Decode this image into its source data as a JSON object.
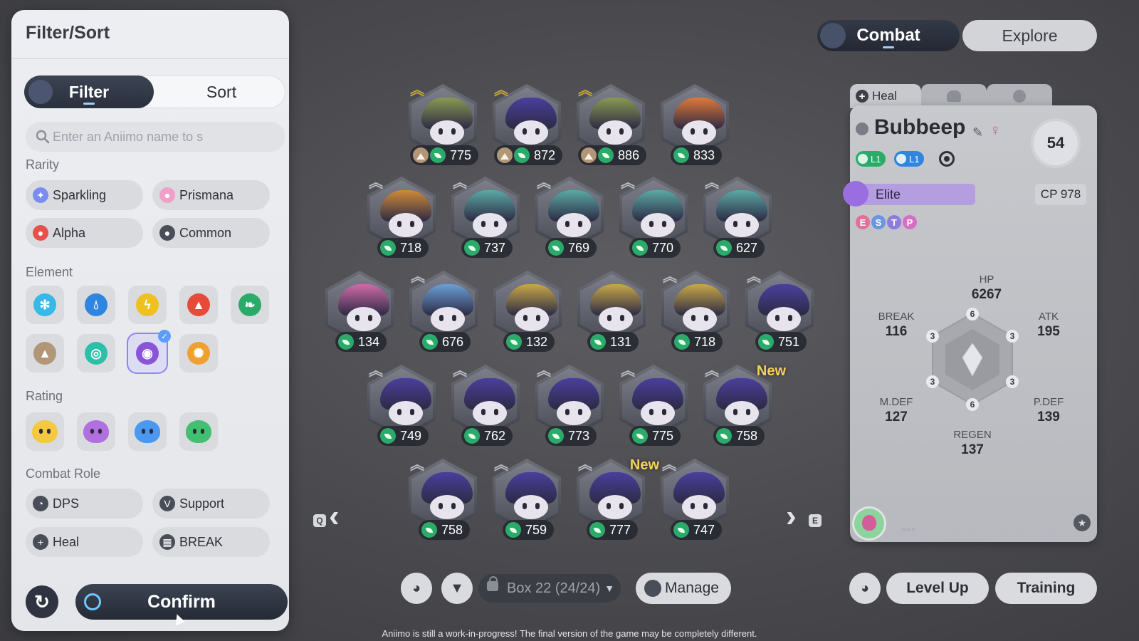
{
  "filter_panel": {
    "title": "Filter/Sort",
    "tabs": {
      "filter": "Filter",
      "sort": "Sort"
    },
    "search_placeholder": "Enter an Aniimo name to s",
    "rarity": {
      "heading": "Rarity",
      "options": [
        "Sparkling",
        "Prismana",
        "Alpha",
        "Common"
      ]
    },
    "element": {
      "heading": "Element",
      "options": [
        "ice-icon",
        "water-icon",
        "electric-icon",
        "fire-icon",
        "grass-icon",
        "rock-icon",
        "wind-icon",
        "psychic-icon",
        "light-icon"
      ],
      "selected": "psychic-icon"
    },
    "rating": {
      "heading": "Rating",
      "options": [
        "gold-face-icon",
        "purple-face-icon",
        "blue-face-icon",
        "green-face-icon"
      ]
    },
    "combat_role": {
      "heading": "Combat Role",
      "options": [
        "DPS",
        "Support",
        "Heal",
        "BREAK"
      ]
    },
    "confirm_label": "Confirm"
  },
  "top_tabs": {
    "combat": "Combat",
    "explore": "Explore",
    "active": "Combat"
  },
  "grid": {
    "rows": [
      [
        {
          "cp": "775",
          "elements": [
            "rock",
            "grass"
          ],
          "color": "#8a9a52",
          "rank": "gold"
        },
        {
          "cp": "872",
          "elements": [
            "rock",
            "grass"
          ],
          "color": "#4b3f9e",
          "rank": "gold"
        },
        {
          "cp": "886",
          "elements": [
            "rock",
            "grass"
          ],
          "color": "#8a9a52",
          "rank": "gold"
        },
        {
          "cp": "833",
          "elements": [
            "grass"
          ],
          "color": "#e07838",
          "rank": "none"
        }
      ],
      [
        {
          "cp": "718",
          "elements": [
            "grass"
          ],
          "color": "#d08a38",
          "rank": "grey"
        },
        {
          "cp": "737",
          "elements": [
            "grass"
          ],
          "color": "#5aa8a4",
          "rank": "grey"
        },
        {
          "cp": "769",
          "elements": [
            "grass"
          ],
          "color": "#5aa8a4",
          "rank": "grey"
        },
        {
          "cp": "770",
          "elements": [
            "grass"
          ],
          "color": "#5aa8a4",
          "rank": "grey"
        },
        {
          "cp": "627",
          "elements": [
            "grass"
          ],
          "color": "#5aa8a4",
          "rank": "grey"
        }
      ],
      [
        {
          "cp": "134",
          "elements": [
            "grass"
          ],
          "color": "#d06aa8",
          "rank": "none"
        },
        {
          "cp": "676",
          "elements": [
            "grass"
          ],
          "color": "#6aa0d6",
          "rank": "grey"
        },
        {
          "cp": "132",
          "elements": [
            "grass"
          ],
          "color": "#c8a848",
          "rank": "none"
        },
        {
          "cp": "131",
          "elements": [
            "grass"
          ],
          "color": "#c8a848",
          "rank": "none"
        },
        {
          "cp": "718",
          "elements": [
            "grass"
          ],
          "color": "#c8a848",
          "rank": "grey"
        },
        {
          "cp": "751",
          "elements": [
            "grass"
          ],
          "color": "#4b3f9e",
          "rank": "grey"
        }
      ],
      [
        {
          "cp": "749",
          "elements": [
            "grass"
          ],
          "color": "#4b3f9e",
          "rank": "grey"
        },
        {
          "cp": "762",
          "elements": [
            "grass"
          ],
          "color": "#4b3f9e",
          "rank": "grey"
        },
        {
          "cp": "773",
          "elements": [
            "grass"
          ],
          "color": "#4b3f9e",
          "rank": "grey"
        },
        {
          "cp": "775",
          "elements": [
            "grass"
          ],
          "color": "#4b3f9e",
          "rank": "grey"
        },
        {
          "cp": "758",
          "elements": [
            "grass"
          ],
          "color": "#4b3f9e",
          "rank": "grey",
          "tag": "New"
        }
      ],
      [
        {
          "cp": "758",
          "elements": [
            "grass"
          ],
          "color": "#4b3f9e",
          "rank": "grey"
        },
        {
          "cp": "759",
          "elements": [
            "grass"
          ],
          "color": "#4b3f9e",
          "rank": "grey"
        },
        {
          "cp": "777",
          "elements": [
            "grass"
          ],
          "color": "#4b3f9e",
          "rank": "grey",
          "tag": "New"
        },
        {
          "cp": "747",
          "elements": [
            "grass"
          ],
          "color": "#4b3f9e",
          "rank": "grey"
        }
      ]
    ],
    "prev_key": "Q",
    "next_key": "E"
  },
  "bottom_bar": {
    "box_label": "Box 22 (24/24)",
    "manage_label": "Manage",
    "level_up_label": "Level Up",
    "training_label": "Training"
  },
  "detail": {
    "tabs": {
      "role": "Heal"
    },
    "name": "Bubbeep",
    "level": "54",
    "skills": [
      "L1",
      "L1"
    ],
    "quality": "Elite",
    "cp": "CP 978",
    "letters": [
      "E",
      "S",
      "T",
      "P"
    ],
    "stats": {
      "hp": {
        "label": "HP",
        "value": "6267"
      },
      "break": {
        "label": "BREAK",
        "value": "116"
      },
      "atk": {
        "label": "ATK",
        "value": "195"
      },
      "mdef": {
        "label": "M.DEF",
        "value": "127"
      },
      "pdef": {
        "label": "P.DEF",
        "value": "139"
      },
      "regen": {
        "label": "REGEN",
        "value": "137"
      }
    },
    "radar_nodes": [
      "6",
      "3",
      "3",
      "3",
      "3",
      "6"
    ]
  },
  "footer_note": "Aniimo is still a work-in-progress! The final version of the game may be completely different.",
  "colors": {
    "accent_dark": "#2a303c",
    "grass": "#2bab6a",
    "elite": "#b49ee0",
    "new_tag": "#f3d35a"
  }
}
